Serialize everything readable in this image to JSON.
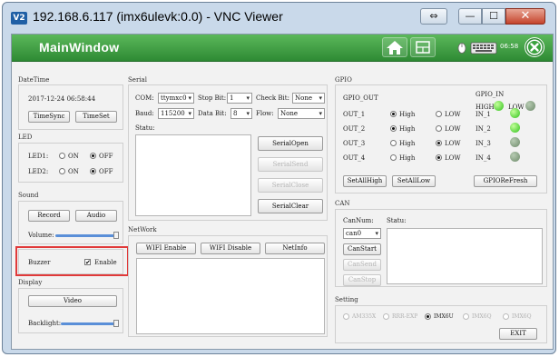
{
  "vnc": {
    "title": "192.168.6.117 (imx6ulevk:0.0) - VNC Viewer",
    "logo": "V2"
  },
  "app": {
    "title": "MainWindow",
    "clock": "06:58"
  },
  "datetime": {
    "label": "DateTime",
    "value": "2017-12-24 06:58:44",
    "timesync": "TimeSync",
    "timeset": "TimeSet"
  },
  "led": {
    "label": "LED",
    "led1": "LED1:",
    "led2": "LED2:",
    "on": "ON",
    "off": "OFF",
    "led1_state": "OFF",
    "led2_state": "OFF"
  },
  "sound": {
    "label": "Sound",
    "record": "Record",
    "audio": "Audio",
    "volume": "Volume:",
    "volume_level": 1.0
  },
  "buzzer": {
    "label": "Buzzer",
    "enable": "Enable",
    "checked": true,
    "check_mark": "✔"
  },
  "display": {
    "label": "Display",
    "video": "Video",
    "backlight": "Backlight:",
    "backlight_level": 1.0
  },
  "serial": {
    "label": "Serial",
    "com_label": "COM:",
    "com": "ttymxc0",
    "stopbit_label": "Stop Bit:",
    "stopbit": "1",
    "checkbit_label": "Check Bit:",
    "checkbit": "None",
    "baud_label": "Baud:",
    "baud": "115200",
    "databit_label": "Data Bit:",
    "databit": "8",
    "flow_label": "Flow:",
    "flow": "None",
    "status_label": "Statu:",
    "open": "SerialOpen",
    "send": "SerialSend",
    "close": "SerialClose",
    "clear": "SerialClear"
  },
  "network": {
    "label": "NetWork",
    "wifi_enable": "WIFI Enable",
    "wifi_disable": "WIFI Disable",
    "netinfo": "NetInfo"
  },
  "gpio": {
    "label": "GPIO",
    "out_label": "GPIO_OUT",
    "in_label": "GPIO_IN",
    "high": "High",
    "low": "LOW",
    "in_high": "HIGH",
    "in_low": "LOW",
    "outputs": [
      {
        "name": "OUT_1",
        "state": "High"
      },
      {
        "name": "OUT_2",
        "state": "High"
      },
      {
        "name": "OUT_3",
        "state": "LOW"
      },
      {
        "name": "OUT_4",
        "state": "LOW"
      }
    ],
    "inputs": [
      {
        "name": "IN_1",
        "on": true
      },
      {
        "name": "IN_2",
        "on": true
      },
      {
        "name": "IN_3",
        "on": false
      },
      {
        "name": "IN_4",
        "on": false
      }
    ],
    "set_all_high": "SetAllHigh",
    "set_all_low": "SetAllLow",
    "refresh": "GPIOReFresh"
  },
  "can": {
    "label": "CAN",
    "num_label": "CanNum:",
    "num": "can0",
    "status_label": "Statu:",
    "start": "CanStart",
    "send": "CanSend",
    "stop": "CanStop"
  },
  "setting": {
    "label": "Setting",
    "options": [
      "AM335X",
      "RRR-EXP",
      "IMX6U",
      "IMX6Q",
      "IMX6Q"
    ],
    "selected": "IMX6U",
    "exit": "EXIT"
  },
  "colors": {
    "header_green": "#3a9c3e",
    "highlight": "#e03a3a",
    "led_on": "#2fc21a"
  }
}
